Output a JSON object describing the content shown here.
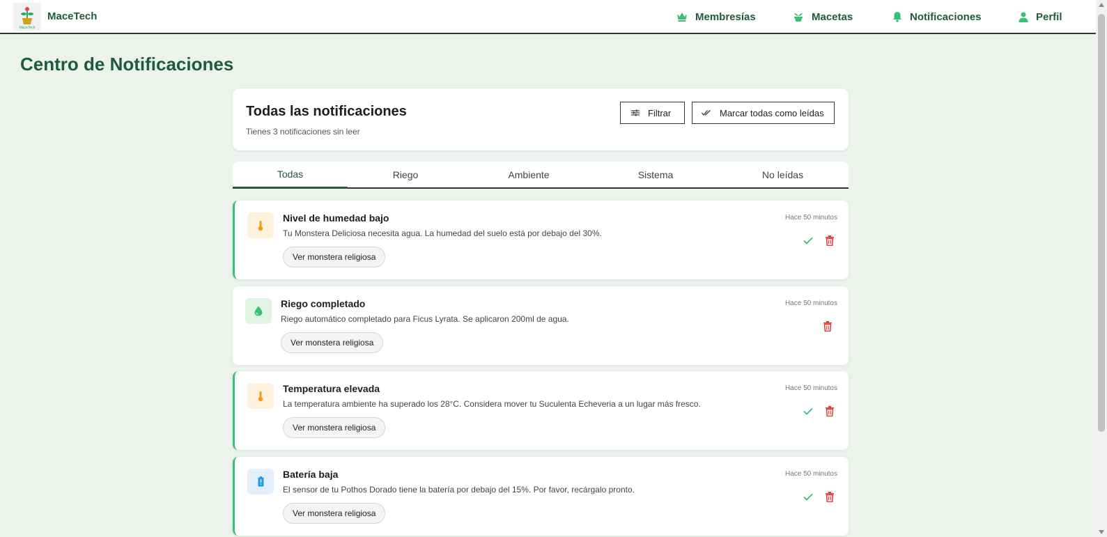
{
  "app": {
    "brand": "MaceTech",
    "logo_text": "MaceTech"
  },
  "nav": [
    {
      "label": "Membresías",
      "icon": "crown-icon"
    },
    {
      "label": "Macetas",
      "icon": "plant-pot-icon"
    },
    {
      "label": "Notificaciones",
      "icon": "bell-icon"
    },
    {
      "label": "Perfil",
      "icon": "user-icon"
    }
  ],
  "page": {
    "title": "Centro de Notificaciones"
  },
  "header": {
    "title": "Todas las notificaciones",
    "subtitle": "Tienes 3 notificaciones sin leer",
    "filter_label": "Filtrar",
    "mark_all_label": "Marcar todas como leídas"
  },
  "tabs": [
    {
      "label": "Todas",
      "active": true
    },
    {
      "label": "Riego",
      "active": false
    },
    {
      "label": "Ambiente",
      "active": false
    },
    {
      "label": "Sistema",
      "active": false
    },
    {
      "label": "No leídas",
      "active": false
    }
  ],
  "notifications": [
    {
      "title": "Nivel de humedad bajo",
      "message": "Tu Monstera Deliciosa necesita agua. La humedad del suelo está por debajo del 30%.",
      "button": "Ver monstera religiosa",
      "time": "Hace 50 minutos",
      "icon": "thermometer-icon",
      "unread": true
    },
    {
      "title": "Riego completado",
      "message": "Riego automático completado para Ficus Lyrata. Se aplicaron 200ml de agua.",
      "button": "Ver monstera religiosa",
      "time": "Hace 50 minutos",
      "icon": "water-drop-icon",
      "unread": false
    },
    {
      "title": "Temperatura elevada",
      "message": "La temperatura ambiente ha superado los 28°C. Considera mover tu Suculenta Echeveria a un lugar más fresco.",
      "button": "Ver monstera religiosa",
      "time": "Hace 50 minutos",
      "icon": "thermometer-icon",
      "unread": true
    },
    {
      "title": "Batería baja",
      "message": "El sensor de tu Pothos Dorado tiene la batería por debajo del 15%. Por favor, recárgalo pronto.",
      "button": "Ver monstera religiosa",
      "time": "Hace 50 minutos",
      "icon": "battery-alert-icon",
      "unread": true
    }
  ],
  "colors": {
    "brand_green": "#1f5b3a",
    "accent_green": "#38c172",
    "delete_red": "#e53935",
    "warning_orange": "#f39c12",
    "info_blue": "#2196f3",
    "background": "#ecf2ec"
  }
}
